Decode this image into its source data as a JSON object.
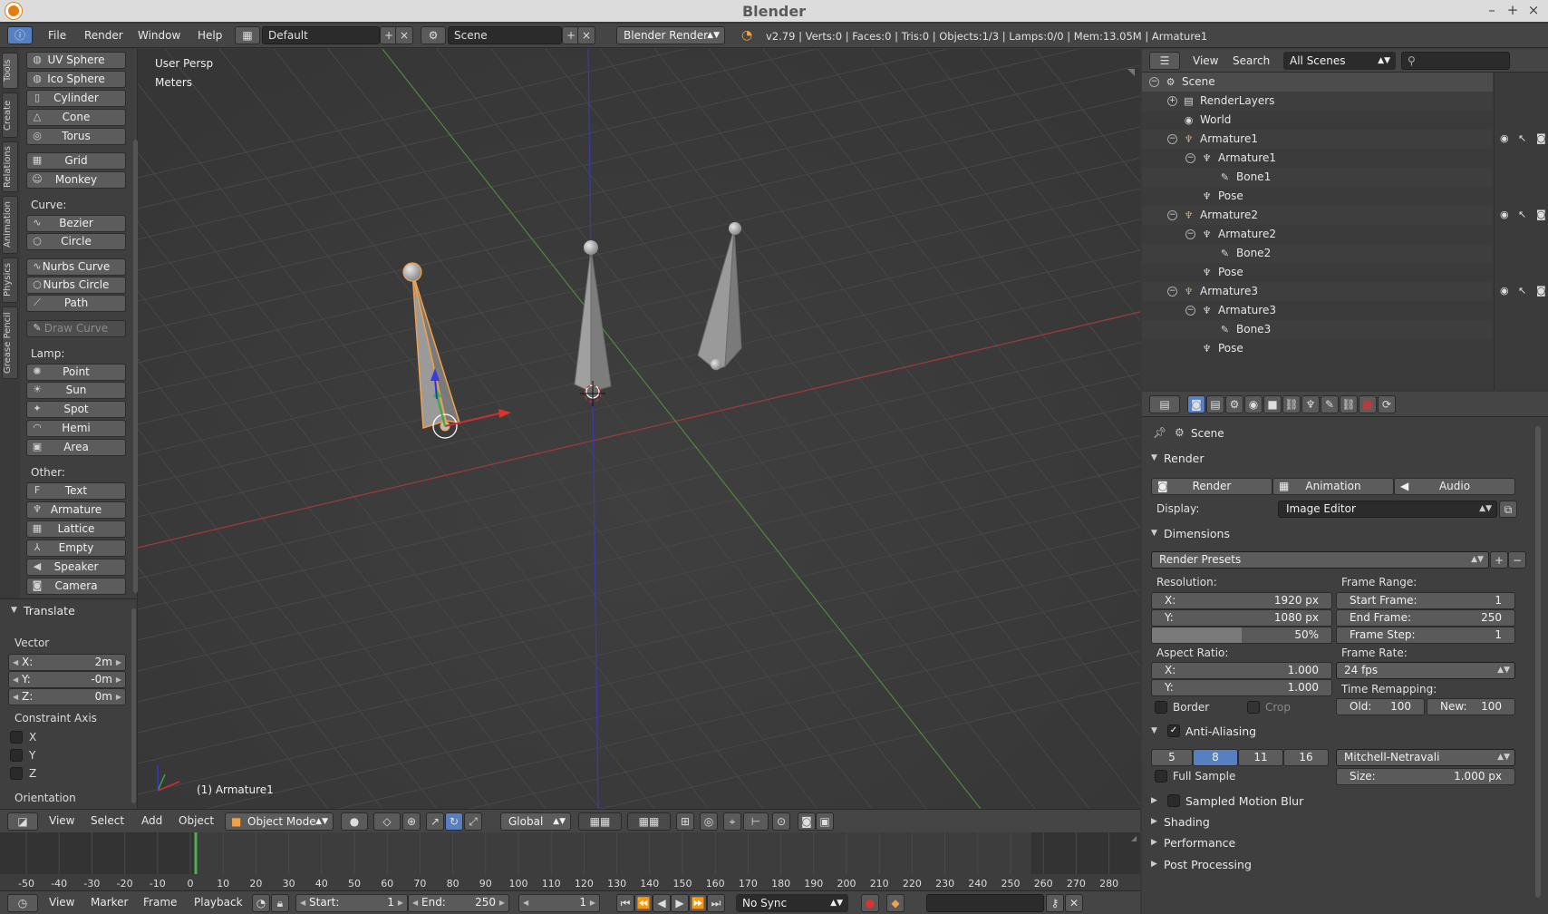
{
  "window": {
    "title": "Blender"
  },
  "info_header": {
    "menus": [
      "File",
      "Render",
      "Window",
      "Help"
    ],
    "screen_layout": "Default",
    "scene": "Scene",
    "render_engine": "Blender Render",
    "stats": "v2.79 | Verts:0 | Faces:0 | Tris:0 | Objects:1/3 | Lamps:0/0 | Mem:13.05M | Armature1"
  },
  "tool_tabs": [
    "Tools",
    "Create",
    "Relations",
    "Animation",
    "Physics",
    "Grease Pencil"
  ],
  "tool_shelf": {
    "mesh_buttons": [
      "UV Sphere",
      "Ico Sphere",
      "Cylinder",
      "Cone",
      "Torus",
      "Grid",
      "Monkey"
    ],
    "curve_label": "Curve:",
    "curve_buttons": [
      "Bezier",
      "Circle",
      "Nurbs Curve",
      "Nurbs Circle",
      "Path"
    ],
    "draw_curve": "Draw Curve",
    "lamp_label": "Lamp:",
    "lamp_buttons": [
      "Point",
      "Sun",
      "Spot",
      "Hemi",
      "Area"
    ],
    "other_label": "Other:",
    "other_buttons": [
      "Text",
      "Armature",
      "Lattice",
      "Empty",
      "Speaker",
      "Camera"
    ]
  },
  "operator_panel": {
    "title": "Translate",
    "vector_label": "Vector",
    "x_label": "X:",
    "x_value": "2m",
    "y_label": "Y:",
    "y_value": "-0m",
    "z_label": "Z:",
    "z_value": "0m",
    "constraint_label": "Constraint Axis",
    "axes": [
      "X",
      "Y",
      "Z"
    ],
    "orientation_label": "Orientation"
  },
  "viewport": {
    "view_name": "User Persp",
    "units": "Meters",
    "active_object": "(1) Armature1"
  },
  "view3d_header": {
    "menus": [
      "View",
      "Select",
      "Add",
      "Object"
    ],
    "mode": "Object Mode",
    "orientation": "Global"
  },
  "timeline": {
    "ticks": [
      "-50",
      "-40",
      "-30",
      "-20",
      "-10",
      "0",
      "10",
      "20",
      "30",
      "40",
      "50",
      "60",
      "70",
      "80",
      "90",
      "100",
      "110",
      "120",
      "130",
      "140",
      "150",
      "160",
      "170",
      "180",
      "190",
      "200",
      "210",
      "220",
      "230",
      "240",
      "250",
      "260",
      "270",
      "280"
    ],
    "current_frame_marker": 0,
    "menus": [
      "View",
      "Marker",
      "Frame",
      "Playback"
    ],
    "start_label": "Start:",
    "start_value": "1",
    "end_label": "End:",
    "end_value": "250",
    "current_frame": "1",
    "sync": "No Sync"
  },
  "outliner_header": {
    "menus": [
      "View",
      "Search"
    ],
    "display_mode": "All Scenes"
  },
  "outliner": {
    "rows": [
      {
        "label": "Scene",
        "indent": 0,
        "icon": "scene-icon"
      },
      {
        "label": "RenderLayers",
        "indent": 1,
        "icon": "renderlayers-icon"
      },
      {
        "label": "World",
        "indent": 1,
        "icon": "world-icon"
      },
      {
        "label": "Armature1",
        "indent": 1,
        "icon": "armature-object-icon",
        "vis": true
      },
      {
        "label": "Armature1",
        "indent": 2,
        "icon": "armature-data-icon"
      },
      {
        "label": "Bone1",
        "indent": 3,
        "icon": "bone-icon"
      },
      {
        "label": "Pose",
        "indent": 2,
        "icon": "pose-icon"
      },
      {
        "label": "Armature2",
        "indent": 1,
        "icon": "armature-object-icon",
        "vis": true
      },
      {
        "label": "Armature2",
        "indent": 2,
        "icon": "armature-data-icon"
      },
      {
        "label": "Bone2",
        "indent": 3,
        "icon": "bone-icon"
      },
      {
        "label": "Pose",
        "indent": 2,
        "icon": "pose-icon"
      },
      {
        "label": "Armature3",
        "indent": 1,
        "icon": "armature-object-icon",
        "vis": true
      },
      {
        "label": "Armature3",
        "indent": 2,
        "icon": "armature-data-icon"
      },
      {
        "label": "Bone3",
        "indent": 3,
        "icon": "bone-icon"
      },
      {
        "label": "Pose",
        "indent": 2,
        "icon": "pose-icon"
      }
    ]
  },
  "properties": {
    "context": "Scene",
    "render_panel": "Render",
    "render_buttons": [
      "Render",
      "Animation",
      "Audio"
    ],
    "display_label": "Display:",
    "display_value": "Image Editor",
    "dimensions_panel": "Dimensions",
    "render_presets": "Render Presets",
    "resolution_label": "Resolution:",
    "res_x_label": "X:",
    "res_x": "1920 px",
    "res_y_label": "Y:",
    "res_y": "1080 px",
    "res_pct": "50%",
    "res_pct_fraction": 0.5,
    "frame_range_label": "Frame Range:",
    "start_frame_label": "Start Frame:",
    "start_frame": "1",
    "end_frame_label": "End Frame:",
    "end_frame": "250",
    "frame_step_label": "Frame Step:",
    "frame_step": "1",
    "aspect_label": "Aspect Ratio:",
    "aspect_x_label": "X:",
    "aspect_x": "1.000",
    "aspect_y_label": "Y:",
    "aspect_y": "1.000",
    "frame_rate_label": "Frame Rate:",
    "frame_rate": "24 fps",
    "time_remap_label": "Time Remapping:",
    "old_label": "Old:",
    "old_value": "100",
    "new_label": "New:",
    "new_value": "100",
    "border_label": "Border",
    "crop_label": "Crop",
    "aa_panel": "Anti-Aliasing",
    "aa_samples": [
      "5",
      "8",
      "11",
      "16"
    ],
    "aa_selected": "8",
    "aa_filter": "Mitchell-Netravali",
    "full_sample_label": "Full Sample",
    "size_label": "Size:",
    "size_value": "1.000 px",
    "collapsed_panels": [
      "Sampled Motion Blur",
      "Shading",
      "Performance",
      "Post Processing"
    ]
  },
  "colors": {
    "accent": "#5680c2",
    "active_orange": "#f1a14a",
    "x_axis": "#a03a3a",
    "y_axis": "#4c8a3c",
    "z_axis": "#3a3aa8"
  }
}
